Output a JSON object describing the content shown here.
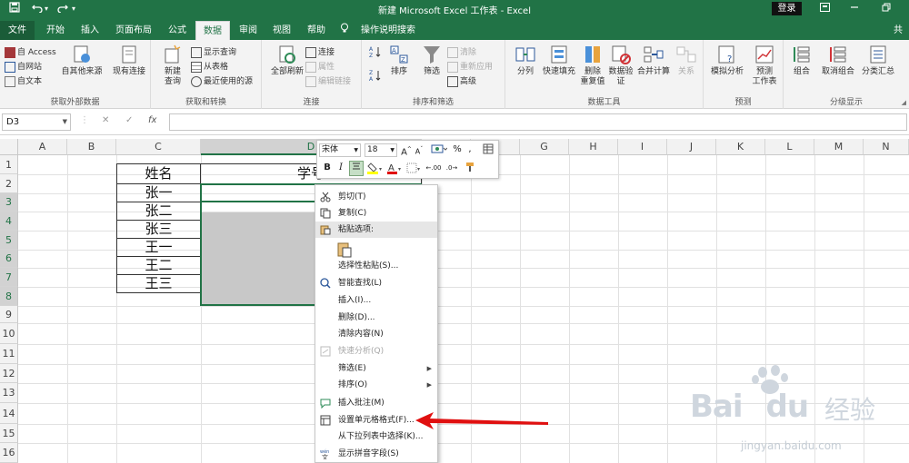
{
  "titlebar": {
    "title": "新建 Microsoft Excel 工作表 - Excel",
    "login": "登录",
    "save_icon": "save-icon",
    "undo_icon": "undo-icon",
    "redo_icon": "redo-icon",
    "ribbon_display_icon": "ribbon-display-icon",
    "minimize_icon": "minimize-icon",
    "restore_icon": "restore-icon",
    "brand_color": "#217346"
  },
  "tabs": [
    {
      "label": "文件"
    },
    {
      "label": "开始"
    },
    {
      "label": "插入"
    },
    {
      "label": "页面布局"
    },
    {
      "label": "公式"
    },
    {
      "label": "数据"
    },
    {
      "label": "审阅"
    },
    {
      "label": "视图"
    },
    {
      "label": "帮助"
    },
    {
      "label": "操作说明搜索"
    },
    {
      "label": "共"
    }
  ],
  "ribbon": {
    "groups": [
      {
        "name": "获取外部数据",
        "items": [
          "自 Access",
          "自网站",
          "自文本",
          "自其他来源",
          "现有连接"
        ]
      },
      {
        "name": "获取和转换",
        "items": [
          "新建",
          "查询",
          "显示查询",
          "从表格",
          "最近使用的源"
        ]
      },
      {
        "name": "连接",
        "items": [
          "全部刷新",
          "连接",
          "属性",
          "编辑链接"
        ]
      },
      {
        "name": "排序和筛选",
        "items": [
          "排序",
          "筛选",
          "清除",
          "重新应用",
          "高级"
        ]
      },
      {
        "name": "数据工具",
        "items": [
          "分列",
          "快速填充",
          "删除",
          "重复值",
          "数据验",
          "证",
          "合并计算",
          "关系"
        ]
      },
      {
        "name": "预测",
        "items": [
          "模拟分析",
          "预测",
          "工作表"
        ]
      },
      {
        "name": "分级显示",
        "items": [
          "组合",
          "取消组合",
          "分类汇总"
        ]
      }
    ]
  },
  "formula_bar": {
    "name_box": "D3",
    "cancel": "✕",
    "enter": "✓",
    "fx": "fx",
    "value": ""
  },
  "columns": [
    "A",
    "B",
    "C",
    "D",
    "E",
    "F",
    "G",
    "H",
    "I",
    "J",
    "K",
    "L",
    "M",
    "N"
  ],
  "rows": [
    "1",
    "2",
    "3",
    "4",
    "5",
    "6",
    "7",
    "8",
    "9",
    "10",
    "11",
    "12",
    "13",
    "14",
    "15",
    "16"
  ],
  "cells": {
    "C2": "姓名",
    "D2": "学号",
    "C3": "张一",
    "C4": "张二",
    "C5": "张三",
    "C6": "王一",
    "C7": "王二",
    "C8": "王三"
  },
  "mini_toolbar": {
    "font": "宋体",
    "size": "18",
    "grow": "A",
    "shrink": "A",
    "percent": "%",
    "comma": ",",
    "bold": "B",
    "italic": "I",
    "decimal_up": ".00",
    "decimal_down": ".0"
  },
  "context_menu": {
    "items": [
      {
        "label": "剪切(T)",
        "icon": "cut-icon"
      },
      {
        "label": "复制(C)",
        "icon": "copy-icon"
      },
      {
        "label": "粘贴选项:",
        "icon": "paste-icon"
      },
      {
        "label": "",
        "icon": "paste-option-icon"
      },
      {
        "label": "选择性粘贴(S)...",
        "icon": ""
      },
      {
        "label": "智能查找(L)",
        "icon": "smart-lookup-icon"
      },
      {
        "label": "插入(I)...",
        "icon": ""
      },
      {
        "label": "删除(D)...",
        "icon": ""
      },
      {
        "label": "清除内容(N)",
        "icon": ""
      },
      {
        "label": "快速分析(Q)",
        "icon": "quick-analysis-icon"
      },
      {
        "label": "筛选(E)",
        "icon": ""
      },
      {
        "label": "排序(O)",
        "icon": ""
      },
      {
        "label": "插入批注(M)",
        "icon": "insert-comment-icon"
      },
      {
        "label": "设置单元格格式(F)...",
        "icon": "format-cells-icon"
      },
      {
        "label": "从下拉列表中选择(K)...",
        "icon": ""
      },
      {
        "label": "显示拼音字段(S)",
        "icon": "phonetic-icon"
      }
    ]
  },
  "watermark": {
    "brand": "Bai",
    "brand2": "du",
    "cn": "经验",
    "url": "jingyan.baidu.com"
  }
}
